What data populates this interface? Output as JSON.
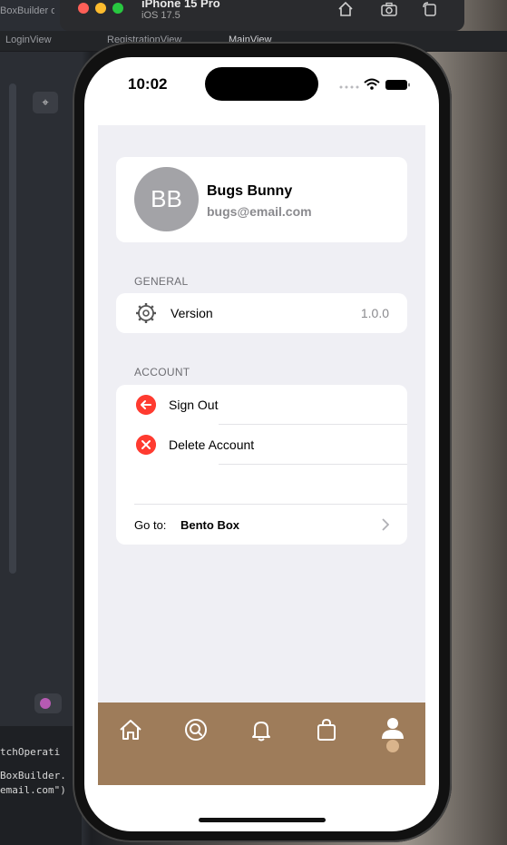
{
  "xcode": {
    "breadcrumb": "BoxBuilder on",
    "tabs": [
      "LoginView",
      "RegistrationView",
      "MainView"
    ],
    "console_lines": [
      "tchOperati",
      "BoxBuilder.",
      "email.com\")"
    ]
  },
  "simulator": {
    "device": "iPhone 15 Pro",
    "os": "iOS 17.5"
  },
  "status_bar": {
    "time": "10:02"
  },
  "profile": {
    "initials": "BB",
    "name": "Bugs Bunny",
    "email": "bugs@email.com"
  },
  "general": {
    "header": "GENERAL",
    "version_label": "Version",
    "version_value": "1.0.0"
  },
  "account": {
    "header": "ACCOUNT",
    "sign_out": "Sign Out",
    "delete_account": "Delete Account",
    "goto_prefix": "Go to:",
    "goto_target": "Bento Box"
  },
  "tabbar": {
    "items": [
      "home-icon",
      "search-icon",
      "bell-icon",
      "bag-icon",
      "person-icon"
    ],
    "selected": "person-icon",
    "color": "#9e7c5a"
  },
  "colors": {
    "destructive": "#ff3b30",
    "avatar": "#a3a3a7"
  }
}
